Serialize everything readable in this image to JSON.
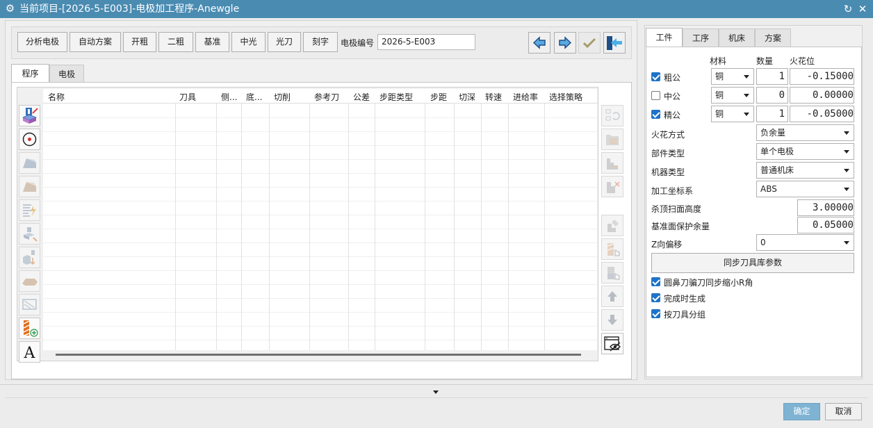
{
  "window": {
    "title": "当前项目-[2026-5-E003]-电极加工程序-Anewgle",
    "icons": [
      "gear-icon",
      "refresh-icon",
      "close-icon"
    ]
  },
  "toolbar": {
    "buttons": [
      "分析电极",
      "自动方案",
      "开粗",
      "二粗",
      "基准",
      "中光",
      "光刀",
      "刻字"
    ],
    "electrode_number_label": "电极编号",
    "electrode_number_value": "2026-5-E003",
    "nav_icons": [
      "arrow-left-icon",
      "arrow-right-icon",
      "check-icon",
      "exit-icon"
    ]
  },
  "left_tabs": [
    "程序",
    "电极"
  ],
  "program_table": {
    "columns": [
      "名称",
      "刀具",
      "侧...",
      "底...",
      "切削",
      "参考刀",
      "公差",
      "步距类型",
      "步距",
      "切深",
      "转速",
      "进给率",
      "选择策略"
    ],
    "rows": []
  },
  "left_tools": [
    "add-program-icon",
    "target-icon",
    "roughing-icon",
    "finishing-icon",
    "report-icon",
    "transform-icon",
    "datum-icon",
    "stock-icon",
    "simulate-icon",
    "electrode-add-icon",
    "text-icon"
  ],
  "right_tools": [
    "replace-icon",
    "folder-icon",
    "steps-icon",
    "delete-icon",
    "copy-icon",
    "select-hand-icon",
    "pick-hand-icon",
    "move-up-icon",
    "move-down-icon",
    "hide-view-icon"
  ],
  "right_tabs": [
    "工件",
    "工序",
    "机床",
    "方案"
  ],
  "workpiece": {
    "headers": {
      "material": "材料",
      "quantity": "数量",
      "spark_gap": "火花位"
    },
    "rows": [
      {
        "label": "粗公",
        "checked": true,
        "material": "铜",
        "quantity": "1",
        "spark": "-0.15000"
      },
      {
        "label": "中公",
        "checked": false,
        "material": "铜",
        "quantity": "0",
        "spark": "0.00000"
      },
      {
        "label": "精公",
        "checked": true,
        "material": "铜",
        "quantity": "1",
        "spark": "-0.05000"
      }
    ],
    "spark_mode": {
      "label": "火花方式",
      "value": "负余量"
    },
    "part_type": {
      "label": "部件类型",
      "value": "单个电极"
    },
    "machine_type": {
      "label": "机器类型",
      "value": "普通机床"
    },
    "wcs": {
      "label": "加工坐标系",
      "value": "ABS"
    },
    "top_clear_height": {
      "label": "杀顶扫面高度",
      "value": "3.00000"
    },
    "datum_stock": {
      "label": "基准面保护余量",
      "value": "0.05000"
    },
    "z_offset": {
      "label": "Z向偏移",
      "value": "0"
    },
    "sync_button": "同步刀具库参数",
    "options": [
      {
        "label": "圆鼻刀骗刀同步缩小R角",
        "checked": true
      },
      {
        "label": "完成时生成",
        "checked": true
      },
      {
        "label": "按刀具分组",
        "checked": true
      }
    ]
  },
  "footer": {
    "ok": "确定",
    "cancel": "取消"
  },
  "colors": {
    "titlebar": "#4a8bb1",
    "ok_button": "#7fb3d3",
    "checkbox": "#1e73c8"
  }
}
